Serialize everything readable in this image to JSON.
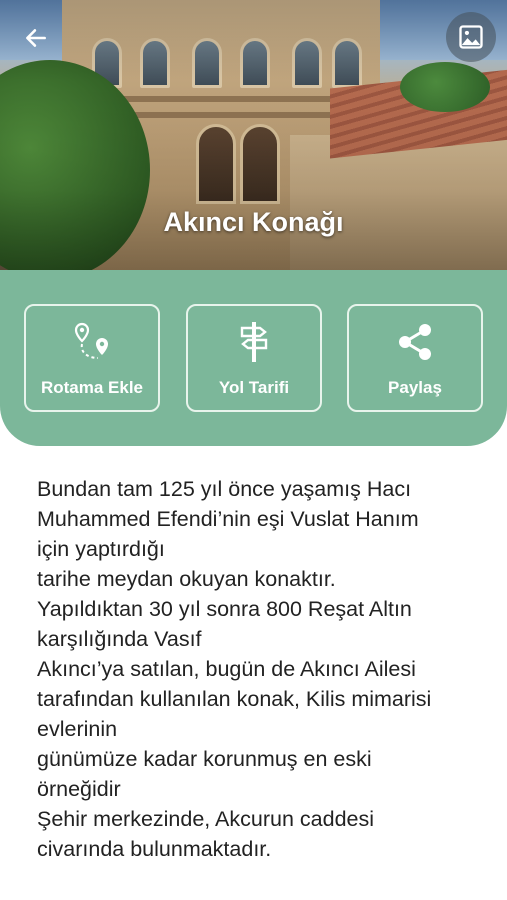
{
  "header": {
    "title": "Akıncı Konağı",
    "back_icon": "arrow-left-icon",
    "gallery_icon": "image-icon"
  },
  "actions": [
    {
      "label": "Rotama Ekle",
      "icon": "route-pin-icon"
    },
    {
      "label": "Yol Tarifi",
      "icon": "signpost-icon"
    },
    {
      "label": "Paylaş",
      "icon": "share-icon"
    }
  ],
  "description": {
    "lines": [
      "Bundan tam 125 yıl önce yaşamış Hacı",
      "Muhammed Efendi’nin eşi Vuslat Hanım",
      "için yaptırdığı",
      "tarihe meydan okuyan konaktır.",
      "Yapıldıktan 30 yıl sonra 800 Reşat Altın",
      "karşılığında Vasıf",
      "Akıncı’ya satılan, bugün de Akıncı Ailesi",
      "tarafından kullanılan konak, Kilis mimarisi",
      "evlerinin",
      "günümüze kadar korunmuş en eski",
      "örneğidir",
      "Şehir merkezinde, Akcurun caddesi",
      "civarında bulunmaktadır."
    ]
  },
  "colors": {
    "accent": "#7cb79a",
    "text": "#222222",
    "on_accent": "#ffffff"
  }
}
